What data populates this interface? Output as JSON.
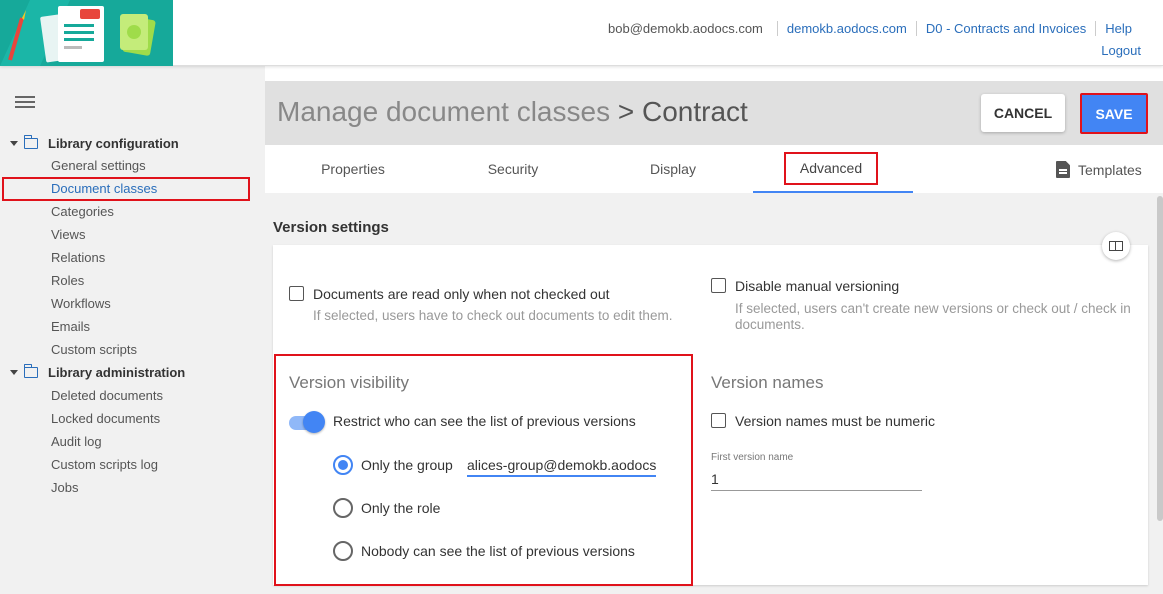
{
  "header": {
    "user_email": "bob@demokb.aodocs.com",
    "links": [
      "demokb.aodocs.com",
      "D0 - Contracts and Invoices",
      "Help"
    ],
    "logout": "Logout"
  },
  "sidebar": {
    "sections": [
      {
        "title": "Library configuration",
        "items": [
          "General settings",
          "Document classes",
          "Categories",
          "Views",
          "Relations",
          "Roles",
          "Workflows",
          "Emails",
          "Custom scripts"
        ]
      },
      {
        "title": "Library administration",
        "items": [
          "Deleted documents",
          "Locked documents",
          "Audit log",
          "Custom scripts log",
          "Jobs"
        ]
      }
    ],
    "active_item": "Document classes"
  },
  "page": {
    "title": "Manage document classes",
    "subtitle": "> Contract",
    "cancel_label": "CANCEL",
    "save_label": "SAVE"
  },
  "tabs": {
    "items": [
      "Properties",
      "Security",
      "Display",
      "Advanced"
    ],
    "active": "Advanced",
    "templates_label": "Templates"
  },
  "version_settings": {
    "section_title": "Version settings",
    "read_only": {
      "label": "Documents are read only when not checked out",
      "hint": "If selected, users have to check out documents to edit them.",
      "checked": false
    },
    "disable_manual": {
      "label": "Disable manual versioning",
      "hint": "If selected, users can't create new versions or check out / check in documents.",
      "checked": false
    },
    "visibility": {
      "title": "Version visibility",
      "toggle_label": "Restrict who can see the list of previous versions",
      "toggle_on": true,
      "options": [
        "Only the group",
        "Only the role",
        "Nobody can see the list of previous versions"
      ],
      "selected": "Only the group",
      "group_value": "alices-group@demokb.aodocs"
    },
    "names": {
      "title": "Version names",
      "numeric_label": "Version names must be numeric",
      "numeric_checked": false,
      "first_label": "First version name",
      "first_value": "1"
    }
  },
  "colors": {
    "accent": "#4285f4",
    "highlight": "#e0121b",
    "link": "#2a6ebb",
    "logo_bg": "#16a99a"
  }
}
